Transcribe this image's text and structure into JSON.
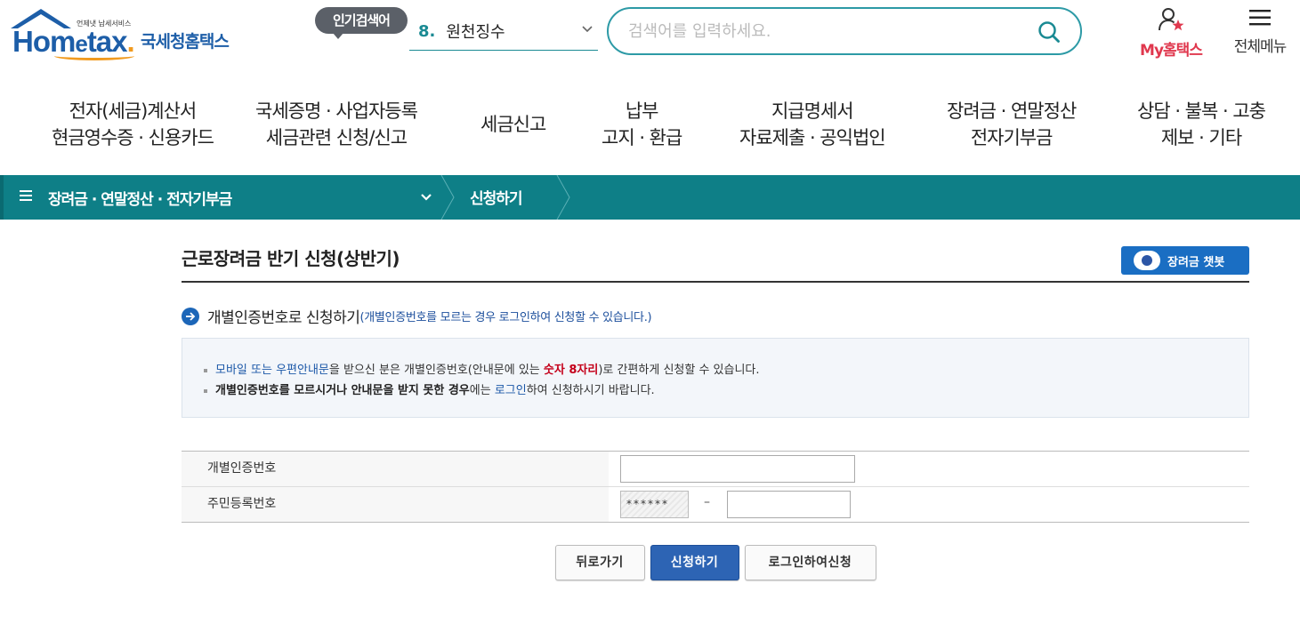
{
  "header": {
    "logo": {
      "tagline": "언제냇 납세서비스",
      "brand_home": "Hom",
      "brand_e": "e",
      "brand_tax": "tax",
      "brand_dot": ".",
      "agency": "국세청홈택스"
    },
    "popular_label": "인기검색어",
    "popular_rank": "8.",
    "popular_term": "원천징수",
    "search_placeholder": "검색어를 입력하세요.",
    "my_hometax_label": "My홈택스",
    "all_menu_label": "전체메뉴"
  },
  "nav": {
    "items": [
      {
        "line1": "전자(세금)계산서",
        "line2": "현금영수증 · 신용카드"
      },
      {
        "line1": "국세증명 · 사업자등록",
        "line2": "세금관련 신청/신고"
      },
      {
        "line1": "세금신고",
        "line2": ""
      },
      {
        "line1": "납부",
        "line2": "고지 · 환급"
      },
      {
        "line1": "지급명세서",
        "line2": "자료제출 · 공익법인"
      },
      {
        "line1": "장려금 · 연말정산",
        "line2": "전자기부금"
      },
      {
        "line1": "상담 · 불복 · 고충",
        "line2": "제보 · 기타"
      }
    ]
  },
  "breadcrumb": {
    "level1": "장려금 · 연말정산 · 전자기부금",
    "level2": "신청하기"
  },
  "page": {
    "title": "근로장려금 반기 신청(상반기)",
    "chatbot_label": "장려금 챗봇",
    "section_heading": "개별인증번호로 신청하기",
    "section_note": "(개별인증번호를 모르는 경우 로그인하여 신청할 수 있습니다.)",
    "info": {
      "line1_link": "모바일 또는 우편안내문",
      "line1_mid": "을 받으신 분은 개별인증번호(안내문에 있는 ",
      "line1_red": "숫자 8자리",
      "line1_end": ")로 간편하게 신청할 수 있습니다.",
      "line2_bold": "개별인증번호를 모르시거나 안내문을 받지 못한 경우",
      "line2_mid": "에는 ",
      "line2_link": "로그인",
      "line2_end": "하여 신청하시기 바랍니다."
    },
    "form": {
      "auth_label": "개별인증번호",
      "auth_value": "",
      "rrn_label": "주민등록번호",
      "rrn_front_masked": "******",
      "rrn_dash": "–",
      "rrn_back_value": ""
    },
    "buttons": {
      "back": "뒤로가기",
      "apply": "신청하기",
      "login_apply": "로그인하여신청"
    }
  },
  "colors": {
    "teal_bar": "#0e7f87",
    "brand_blue": "#1d5ea8",
    "accent_orange": "#f19a1e",
    "my_hometax_red": "#e0384e",
    "primary_button": "#2d64b4"
  }
}
